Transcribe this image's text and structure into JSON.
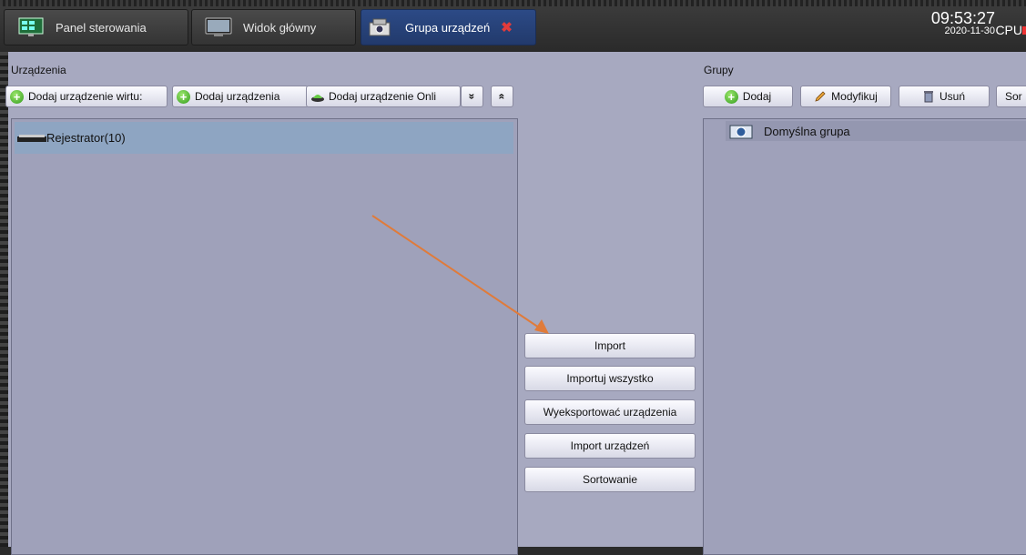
{
  "tabs": [
    {
      "label": "Panel sterowania",
      "icon": "control-panel-icon"
    },
    {
      "label": "Widok główny",
      "icon": "monitor-icon"
    },
    {
      "label": "Grupa urządzeń",
      "icon": "device-group-icon",
      "active": true,
      "close_icon": "close-icon"
    }
  ],
  "status": {
    "time": "09:53:27",
    "date": "2020-11-30",
    "cpu_label": "CPU"
  },
  "devices": {
    "title": "Urządzenia",
    "toolbar": {
      "add_virtual": "Dodaj urządzenie wirtu:",
      "add_device": "Dodaj urządzenia",
      "add_online": "Dodaj urządzenie Onli",
      "expand": "»",
      "collapse": "«"
    },
    "tree": [
      {
        "label": "Rejestrator(10)",
        "icon": "recorder-icon"
      }
    ]
  },
  "actions": {
    "import": "Import",
    "import_all": "Importuj wszystko",
    "export_devices": "Wyeksportować urządzenia",
    "import_devices": "Import urządzeń",
    "sort": "Sortowanie"
  },
  "groups": {
    "title": "Grupy",
    "toolbar": {
      "add": "Dodaj",
      "modify": "Modyfikuj",
      "delete": "Usuń",
      "sort": "Sor"
    },
    "items": [
      {
        "label": "Domyślna grupa",
        "icon": "camera-group-icon"
      }
    ]
  },
  "colors": {
    "annotation_arrow": "#e07b3a",
    "active_tab": "#2c4a86",
    "selected_row": "#8ea5c2"
  }
}
